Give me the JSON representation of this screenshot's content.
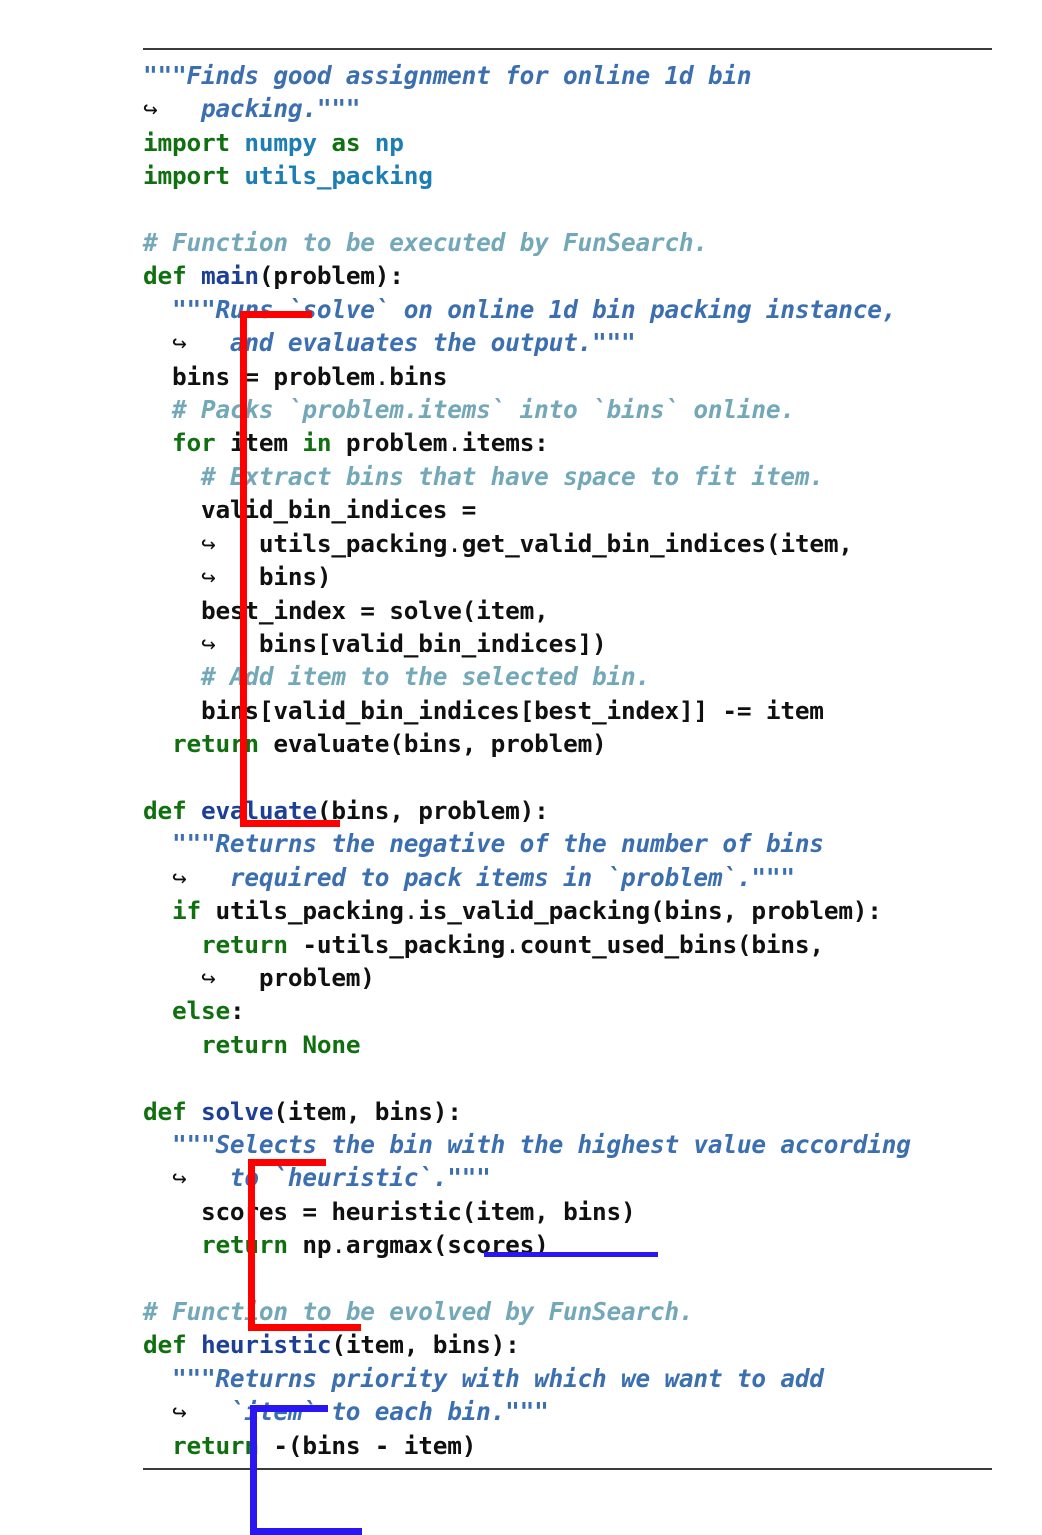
{
  "figure": {
    "kind": "code-listing",
    "language": "python",
    "top_rule": true,
    "bottom_rule": true
  },
  "colors": {
    "keyword": "#107010",
    "function_name": "#1d3f96",
    "module": "#1d7db5",
    "plain": "#101010",
    "string": "#3b6fb0",
    "comment": "#73a8b8",
    "bracket_red": "#fe0000",
    "bracket_blue": "#2916f0",
    "rule": "#3b3b3b",
    "background": "#ffffff"
  },
  "annotations": {
    "bracket_main": {
      "color": "#fe0000",
      "label": "red-bracket-main"
    },
    "bracket_solve": {
      "color": "#fe0000",
      "label": "red-bracket-solve"
    },
    "bracket_heuristic": {
      "color": "#2916f0",
      "label": "blue-bracket-heuristic"
    },
    "underline_heuristic_call": {
      "color": "#2916f0",
      "label": "blue-underline-heuristic"
    }
  },
  "continuation_glyph": "↪",
  "code_lines": [
    {
      "id": "l1",
      "indent": 0,
      "tokens": [
        {
          "t": "\"\"\"Finds good assignment for online 1d bin",
          "c": "str"
        }
      ]
    },
    {
      "id": "l2",
      "indent": 0,
      "wrapped": true,
      "tokens": [
        {
          "t": "packing.\"\"\"",
          "c": "str"
        }
      ]
    },
    {
      "id": "l3",
      "indent": 0,
      "tokens": [
        {
          "t": "import ",
          "c": "kw"
        },
        {
          "t": "numpy",
          "c": "mod"
        },
        {
          "t": " as ",
          "c": "kw"
        },
        {
          "t": "np",
          "c": "mod"
        }
      ]
    },
    {
      "id": "l4",
      "indent": 0,
      "tokens": [
        {
          "t": "import ",
          "c": "kw"
        },
        {
          "t": "utils_packing",
          "c": "mod"
        }
      ]
    },
    {
      "id": "l5",
      "indent": 0,
      "blank": true,
      "tokens": [
        {
          "t": " ",
          "c": "txt"
        }
      ]
    },
    {
      "id": "l6",
      "indent": 0,
      "tokens": [
        {
          "t": "# Function to be executed by FunSearch.",
          "c": "cmt"
        }
      ]
    },
    {
      "id": "l7",
      "indent": 0,
      "tokens": [
        {
          "t": "def ",
          "c": "kw"
        },
        {
          "t": "main",
          "c": "nm"
        },
        {
          "t": "(problem):",
          "c": "txt"
        }
      ]
    },
    {
      "id": "l8",
      "indent": 1,
      "tokens": [
        {
          "t": "\"\"\"Runs `solve` on online 1d bin packing instance,",
          "c": "str"
        }
      ]
    },
    {
      "id": "l9",
      "indent": 1,
      "wrapped": true,
      "tokens": [
        {
          "t": "and evaluates the output.\"\"\"",
          "c": "str"
        }
      ]
    },
    {
      "id": "l10",
      "indent": 1,
      "tokens": [
        {
          "t": "bins = problem",
          "c": "txt"
        },
        {
          "t": ".",
          "c": "cont"
        },
        {
          "t": "bins",
          "c": "txt"
        }
      ]
    },
    {
      "id": "l11",
      "indent": 1,
      "tokens": [
        {
          "t": "# Packs `problem.items` into `bins` online.",
          "c": "cmt"
        }
      ]
    },
    {
      "id": "l12",
      "indent": 1,
      "tokens": [
        {
          "t": "for ",
          "c": "kw"
        },
        {
          "t": "item ",
          "c": "txt"
        },
        {
          "t": "in ",
          "c": "kw"
        },
        {
          "t": "problem",
          "c": "txt"
        },
        {
          "t": ".",
          "c": "cont"
        },
        {
          "t": "items:",
          "c": "txt"
        }
      ]
    },
    {
      "id": "l13",
      "indent": 2,
      "tokens": [
        {
          "t": "# Extract bins that have space to fit item.",
          "c": "cmt"
        }
      ]
    },
    {
      "id": "l14",
      "indent": 2,
      "tokens": [
        {
          "t": "valid_bin_indices =",
          "c": "txt"
        }
      ]
    },
    {
      "id": "l15",
      "indent": 2,
      "wrapped": true,
      "tokens": [
        {
          "t": "utils_packing",
          "c": "txt"
        },
        {
          "t": ".",
          "c": "cont"
        },
        {
          "t": "get_valid_bin_indices(item,",
          "c": "txt"
        }
      ]
    },
    {
      "id": "l16",
      "indent": 2,
      "wrapped": true,
      "tokens": [
        {
          "t": "bins)",
          "c": "txt"
        }
      ]
    },
    {
      "id": "l17",
      "indent": 2,
      "tokens": [
        {
          "t": "best_index = solve(item,",
          "c": "txt"
        }
      ]
    },
    {
      "id": "l18",
      "indent": 2,
      "wrapped": true,
      "tokens": [
        {
          "t": "bins[valid_bin_indices])",
          "c": "txt"
        }
      ]
    },
    {
      "id": "l19",
      "indent": 2,
      "tokens": [
        {
          "t": "# Add item to the selected bin.",
          "c": "cmt"
        }
      ]
    },
    {
      "id": "l20",
      "indent": 2,
      "tokens": [
        {
          "t": "bins[valid_bin_indices[best_index]] -= item",
          "c": "txt"
        }
      ]
    },
    {
      "id": "l21",
      "indent": 1,
      "tokens": [
        {
          "t": "return ",
          "c": "kw"
        },
        {
          "t": "evaluate(bins, problem)",
          "c": "txt"
        }
      ]
    },
    {
      "id": "l22",
      "indent": 0,
      "blank": true,
      "tokens": [
        {
          "t": " ",
          "c": "txt"
        }
      ]
    },
    {
      "id": "l23",
      "indent": 0,
      "tokens": [
        {
          "t": "def ",
          "c": "kw"
        },
        {
          "t": "evaluate",
          "c": "nm"
        },
        {
          "t": "(bins, problem):",
          "c": "txt"
        }
      ]
    },
    {
      "id": "l24",
      "indent": 1,
      "tokens": [
        {
          "t": "\"\"\"Returns the negative of the number of bins",
          "c": "str"
        }
      ]
    },
    {
      "id": "l25",
      "indent": 1,
      "wrapped": true,
      "tokens": [
        {
          "t": "required to pack items in `problem`.\"\"\"",
          "c": "str"
        }
      ]
    },
    {
      "id": "l26",
      "indent": 1,
      "tokens": [
        {
          "t": "if ",
          "c": "kw"
        },
        {
          "t": "utils_packing",
          "c": "txt"
        },
        {
          "t": ".",
          "c": "cont"
        },
        {
          "t": "is_valid_packing(bins, problem):",
          "c": "txt"
        }
      ]
    },
    {
      "id": "l27",
      "indent": 2,
      "tokens": [
        {
          "t": "return ",
          "c": "kw"
        },
        {
          "t": "-utils_packing",
          "c": "txt"
        },
        {
          "t": ".",
          "c": "cont"
        },
        {
          "t": "count_used_bins(bins,",
          "c": "txt"
        }
      ]
    },
    {
      "id": "l28",
      "indent": 2,
      "wrapped": true,
      "tokens": [
        {
          "t": "problem)",
          "c": "txt"
        }
      ]
    },
    {
      "id": "l29",
      "indent": 1,
      "tokens": [
        {
          "t": "else",
          "c": "kw"
        },
        {
          "t": ":",
          "c": "txt"
        }
      ]
    },
    {
      "id": "l30",
      "indent": 2,
      "tokens": [
        {
          "t": "return ",
          "c": "kw"
        },
        {
          "t": "None",
          "c": "kw"
        }
      ]
    },
    {
      "id": "l31",
      "indent": 0,
      "blank": true,
      "tokens": [
        {
          "t": " ",
          "c": "txt"
        }
      ]
    },
    {
      "id": "l32",
      "indent": 0,
      "tokens": [
        {
          "t": "def ",
          "c": "kw"
        },
        {
          "t": "solve",
          "c": "nm"
        },
        {
          "t": "(item, bins):",
          "c": "txt"
        }
      ]
    },
    {
      "id": "l33",
      "indent": 1,
      "tokens": [
        {
          "t": "\"\"\"Selects the bin with the highest value according",
          "c": "str"
        }
      ]
    },
    {
      "id": "l34",
      "indent": 1,
      "wrapped": true,
      "tokens": [
        {
          "t": "to `heuristic`.\"\"\"",
          "c": "str"
        }
      ]
    },
    {
      "id": "l35",
      "indent": 2,
      "tokens": [
        {
          "t": "scores = heuristic(item, bins)",
          "c": "txt"
        }
      ]
    },
    {
      "id": "l36",
      "indent": 2,
      "tokens": [
        {
          "t": "return ",
          "c": "kw"
        },
        {
          "t": "np",
          "c": "txt"
        },
        {
          "t": ".",
          "c": "cont"
        },
        {
          "t": "argmax(scores)",
          "c": "txt"
        }
      ]
    },
    {
      "id": "l37",
      "indent": 0,
      "blank": true,
      "tokens": [
        {
          "t": " ",
          "c": "txt"
        }
      ]
    },
    {
      "id": "l38",
      "indent": 0,
      "tokens": [
        {
          "t": "# Function to be evolved by FunSearch.",
          "c": "cmt"
        }
      ]
    },
    {
      "id": "l39",
      "indent": 0,
      "tokens": [
        {
          "t": "def ",
          "c": "kw"
        },
        {
          "t": "heuristic",
          "c": "nm"
        },
        {
          "t": "(item, bins):",
          "c": "txt"
        }
      ]
    },
    {
      "id": "l40",
      "indent": 1,
      "tokens": [
        {
          "t": "\"\"\"Returns priority with which we want to add",
          "c": "str"
        }
      ]
    },
    {
      "id": "l41",
      "indent": 1,
      "wrapped": true,
      "tokens": [
        {
          "t": "`item` to each bin.\"\"\"",
          "c": "str"
        }
      ]
    },
    {
      "id": "l42",
      "indent": 1,
      "tokens": [
        {
          "t": "return ",
          "c": "kw"
        },
        {
          "t": "-(bins - item)",
          "c": "txt"
        }
      ]
    }
  ]
}
